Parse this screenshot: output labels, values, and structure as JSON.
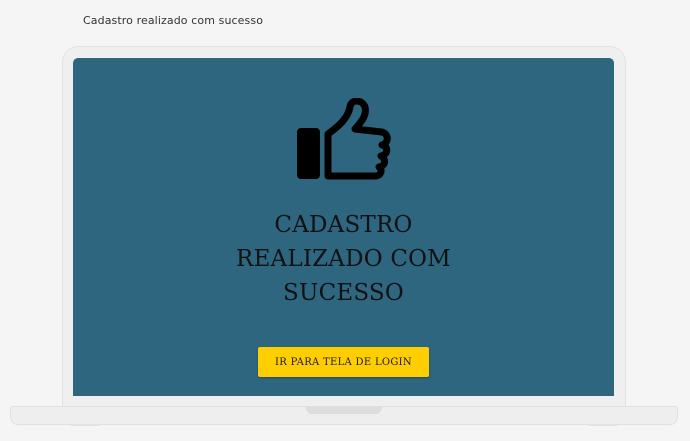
{
  "caption": "Cadastro realizado com sucesso",
  "screen": {
    "icon": "thumbs-up-icon",
    "title_lines": [
      "CADASTRO",
      "REALIZADO COM",
      "SUCESSO"
    ],
    "login_button_label": "IR PARA TELA DE LOGIN"
  },
  "colors": {
    "page_background": "#f5f5f5",
    "screen_background": "#2e6680",
    "button_background": "#ffce00",
    "laptop_frame": "#efefef"
  }
}
